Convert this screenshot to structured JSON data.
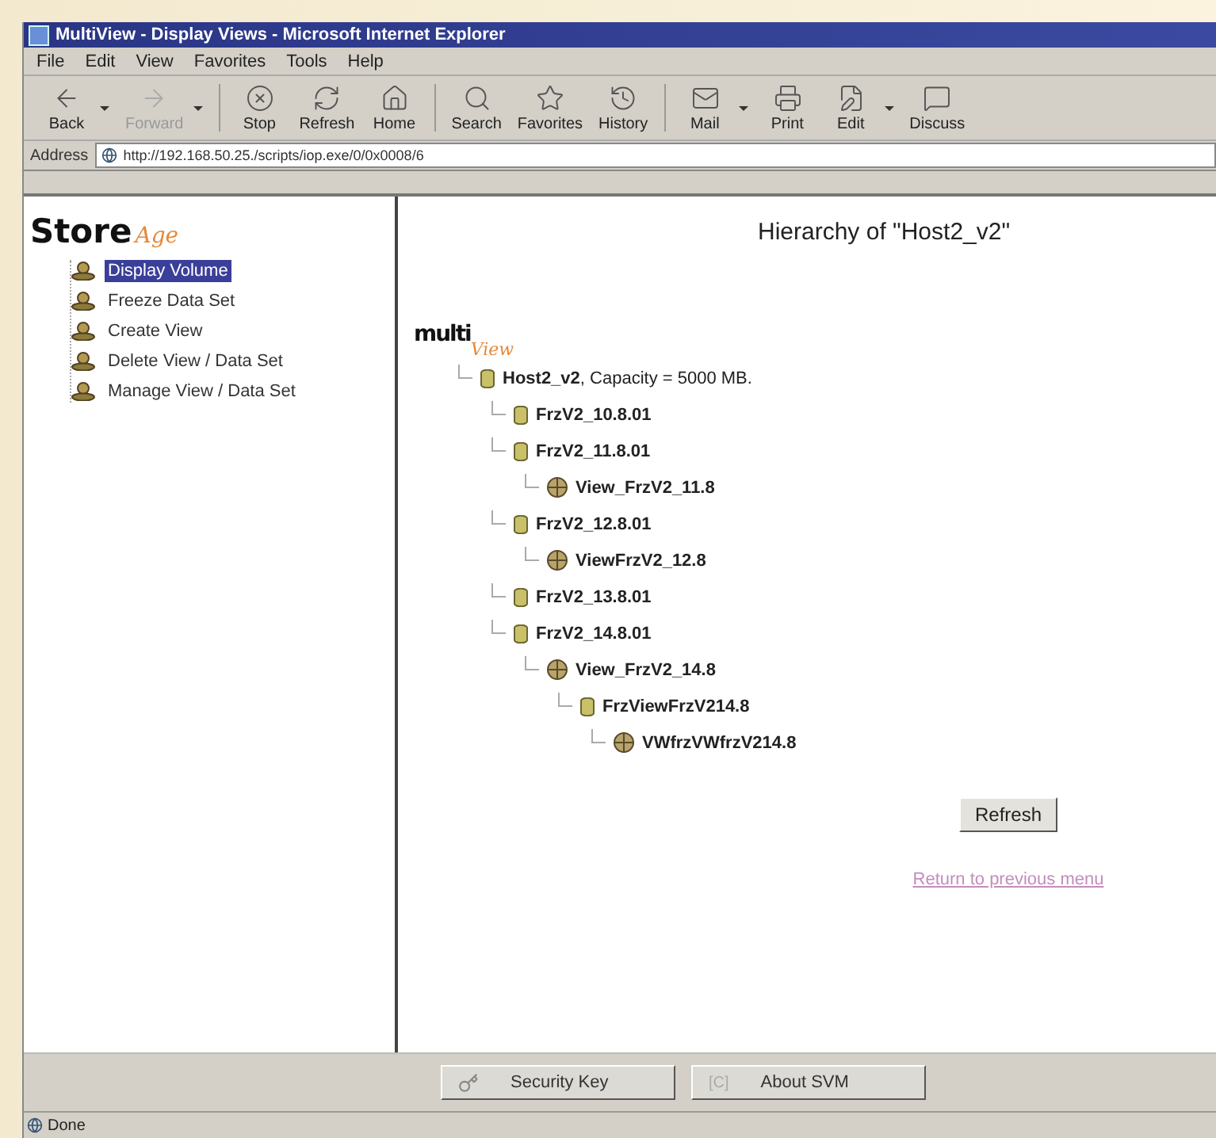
{
  "window": {
    "title": "MultiView - Display Views - Microsoft Internet Explorer"
  },
  "menu": [
    "File",
    "Edit",
    "View",
    "Favorites",
    "Tools",
    "Help"
  ],
  "toolbar": [
    {
      "label": "Back",
      "kind": "back",
      "disabled": false,
      "dropdown": true
    },
    {
      "label": "Forward",
      "kind": "forward",
      "disabled": true,
      "dropdown": true
    },
    {
      "label": "Stop",
      "kind": "stop",
      "disabled": false,
      "dropdown": false
    },
    {
      "label": "Refresh",
      "kind": "refresh",
      "disabled": false,
      "dropdown": false
    },
    {
      "label": "Home",
      "kind": "home",
      "disabled": false,
      "dropdown": false
    },
    {
      "label": "Search",
      "kind": "search",
      "disabled": false,
      "dropdown": false
    },
    {
      "label": "Favorites",
      "kind": "favorites",
      "disabled": false,
      "dropdown": false
    },
    {
      "label": "History",
      "kind": "history",
      "disabled": false,
      "dropdown": false
    },
    {
      "label": "Mail",
      "kind": "mail",
      "disabled": false,
      "dropdown": true
    },
    {
      "label": "Print",
      "kind": "print",
      "disabled": false,
      "dropdown": false
    },
    {
      "label": "Edit",
      "kind": "edit",
      "disabled": false,
      "dropdown": true
    },
    {
      "label": "Discuss",
      "kind": "discuss",
      "disabled": false,
      "dropdown": false
    }
  ],
  "address": {
    "label": "Address",
    "url": "http://192.168.50.25./scripts/iop.exe/0/0x0008/6"
  },
  "sidebar": {
    "logo": {
      "main": "Store",
      "accent": "Age"
    },
    "items": [
      {
        "label": "Display Volume",
        "selected": true
      },
      {
        "label": "Freeze Data Set",
        "selected": false
      },
      {
        "label": "Create View",
        "selected": false
      },
      {
        "label": "Delete View / Data Set",
        "selected": false
      },
      {
        "label": "Manage View / Data Set",
        "selected": false
      }
    ]
  },
  "content": {
    "heading": "Hierarchy of \"Host2_v2\"",
    "logo": {
      "main": "multi",
      "accent": "View"
    },
    "tree": [
      {
        "label": "**Host2_v2**, Capacity = 5000 MB.",
        "kind": "disk",
        "children": [
          {
            "label": "FrzV2_10.8.01",
            "kind": "disk"
          },
          {
            "label": "FrzV2_11.8.01",
            "kind": "disk",
            "children": [
              {
                "label": "View_FrzV2_11.8",
                "kind": "view"
              }
            ]
          },
          {
            "label": "FrzV2_12.8.01",
            "kind": "disk",
            "children": [
              {
                "label": "ViewFrzV2_12.8",
                "kind": "view"
              }
            ]
          },
          {
            "label": "FrzV2_13.8.01",
            "kind": "disk"
          },
          {
            "label": "FrzV2_14.8.01",
            "kind": "disk",
            "children": [
              {
                "label": "View_FrzV2_14.8",
                "kind": "view",
                "children": [
                  {
                    "label": "FrzViewFrzV214.8",
                    "kind": "disk",
                    "children": [
                      {
                        "label": "VWfrzVWfrzV214.8",
                        "kind": "view"
                      }
                    ]
                  }
                ]
              }
            ]
          }
        ]
      }
    ],
    "refresh_button": "Refresh",
    "return_link": "Return to previous menu"
  },
  "bottom_buttons": [
    {
      "label": "Security Key",
      "kind": "key"
    },
    {
      "label": "About SVM",
      "kind": "about",
      "badge": "[C]"
    }
  ],
  "status_bar": "Done"
}
